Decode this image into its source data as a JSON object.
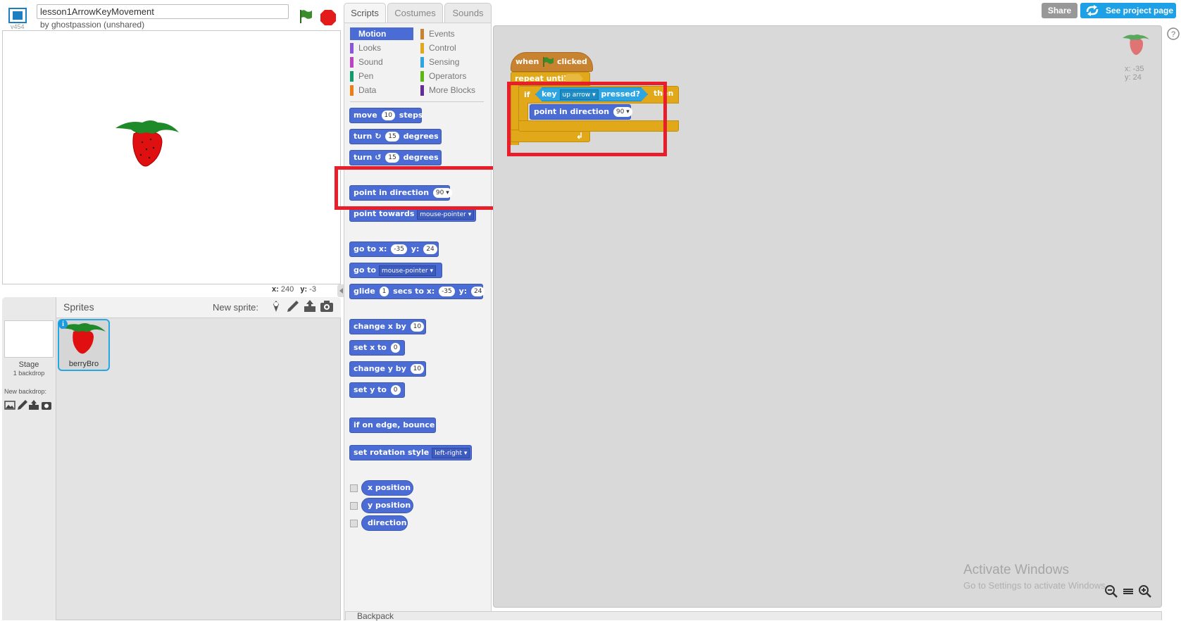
{
  "project": {
    "title": "lesson1ArrowKeyMovement",
    "owner": "by ghostpassion (unshared)",
    "version": "v454"
  },
  "stage": {
    "mouse_x_label": "x:",
    "mouse_x": "240",
    "mouse_y_label": "y:",
    "mouse_y": "-3"
  },
  "sprites_pane": {
    "title": "Sprites",
    "new_sprite_label": "New sprite:",
    "stage_label": "Stage",
    "stage_backdrops": "1 backdrop",
    "new_backdrop_label": "New backdrop:",
    "sprites": [
      {
        "name": "berryBro",
        "info": "i"
      }
    ]
  },
  "tabs": [
    {
      "label": "Scripts",
      "active": true
    },
    {
      "label": "Costumes",
      "active": false
    },
    {
      "label": "Sounds",
      "active": false
    }
  ],
  "categories": [
    {
      "label": "Motion",
      "color": "#4a6cd4",
      "selected": true
    },
    {
      "label": "Events",
      "color": "#c88330"
    },
    {
      "label": "Looks",
      "color": "#8a55d7"
    },
    {
      "label": "Control",
      "color": "#e1a91a"
    },
    {
      "label": "Sound",
      "color": "#bb42c3"
    },
    {
      "label": "Sensing",
      "color": "#2ca5e2"
    },
    {
      "label": "Pen",
      "color": "#0e9a6c"
    },
    {
      "label": "Operators",
      "color": "#5cb712"
    },
    {
      "label": "Data",
      "color": "#ee7d16"
    },
    {
      "label": "More Blocks",
      "color": "#632d99"
    }
  ],
  "blocks": {
    "move": {
      "pre": "move",
      "val": "10",
      "post": "steps"
    },
    "turn_right": {
      "pre": "turn",
      "arrow": "↻",
      "val": "15",
      "post": "degrees"
    },
    "turn_left": {
      "pre": "turn",
      "arrow": "↺",
      "val": "15",
      "post": "degrees"
    },
    "point_direction": {
      "text": "point in direction",
      "val": "90"
    },
    "point_towards": {
      "text": "point towards",
      "val": "mouse-pointer"
    },
    "goto_xy": {
      "pre": "go to x:",
      "x": "-35",
      "mid": "y:",
      "y": "24"
    },
    "goto": {
      "text": "go to",
      "val": "mouse-pointer"
    },
    "glide": {
      "pre": "glide",
      "secs": "1",
      "mid": "secs to x:",
      "x": "-35",
      "mid2": "y:",
      "y": "24"
    },
    "change_x": {
      "text": "change x by",
      "val": "10"
    },
    "set_x": {
      "text": "set x to",
      "val": "0"
    },
    "change_y": {
      "text": "change y by",
      "val": "10"
    },
    "set_y": {
      "text": "set y to",
      "val": "0"
    },
    "bounce": {
      "text": "if on edge, bounce"
    },
    "rotation_style": {
      "text": "set rotation style",
      "val": "left-right"
    },
    "x_position": {
      "text": "x position"
    },
    "y_position": {
      "text": "y position"
    },
    "direction": {
      "text": "direction"
    }
  },
  "script": {
    "hat_pre": "when",
    "hat_post": "clicked",
    "repeat_until": "repeat until",
    "if_label": "if",
    "then_label": "then",
    "key_label": "key",
    "key_value": "up arrow",
    "pressed_label": "pressed?",
    "point_text": "point in direction",
    "point_val": "90"
  },
  "script_area": {
    "sprite_x": "x: -35",
    "sprite_y": "y: 24"
  },
  "top_right": {
    "share": "Share",
    "see_project": "See project page"
  },
  "backpack": "Backpack",
  "windows_watermark": {
    "title": "Activate Windows",
    "subtitle": "Go to Settings to activate Windows."
  }
}
